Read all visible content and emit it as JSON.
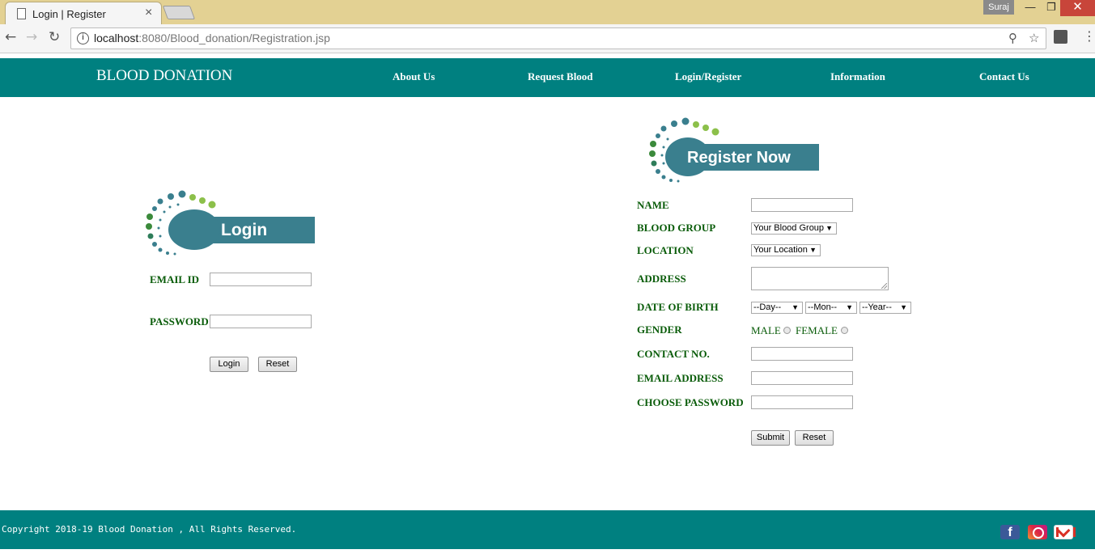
{
  "browser": {
    "tab_title": "Login | Register",
    "tab_close": "×",
    "user_label": "Suraj",
    "minimize": "—",
    "maximize": "❐",
    "close": "✕",
    "url_host": "localhost",
    "url_path": ":8080/Blood_donation/Registration.jsp"
  },
  "header": {
    "brand": "BLOOD DONATION",
    "menu": [
      "About Us",
      "Request Blood",
      "Login/Register",
      "Information",
      "Contact Us"
    ]
  },
  "login": {
    "logo_text": "Login",
    "email_label": "EMAIL ID",
    "password_label": "PASSWORD",
    "login_button": "Login",
    "reset_button": "Reset"
  },
  "register": {
    "logo_text": "Register Now",
    "name_label": "NAME",
    "blood_group_label": "BLOOD GROUP",
    "blood_group_selected": "Your Blood Group",
    "location_label": "LOCATION",
    "location_selected": "Your Location",
    "address_label": "ADDRESS",
    "dob_label": "DATE OF BIRTH",
    "dob_day": "--Day--",
    "dob_month": "--Mon--",
    "dob_year": "--Year--",
    "gender_label": "GENDER",
    "male": "MALE",
    "female": "FEMALE",
    "contact_label": "CONTACT NO.",
    "email_label": "EMAIL ADDRESS",
    "password_label": "CHOOSE PASSWORD",
    "submit_button": "Submit",
    "reset_button": "Reset"
  },
  "footer": {
    "copyright": "Copyright 2018-19 Blood Donation , All Rights Reserved.",
    "facebook_glyph": "f"
  },
  "colors": {
    "theme_teal": "#008080",
    "label_green": "#0a5c0a",
    "logo_teal": "#3a7f8e"
  }
}
